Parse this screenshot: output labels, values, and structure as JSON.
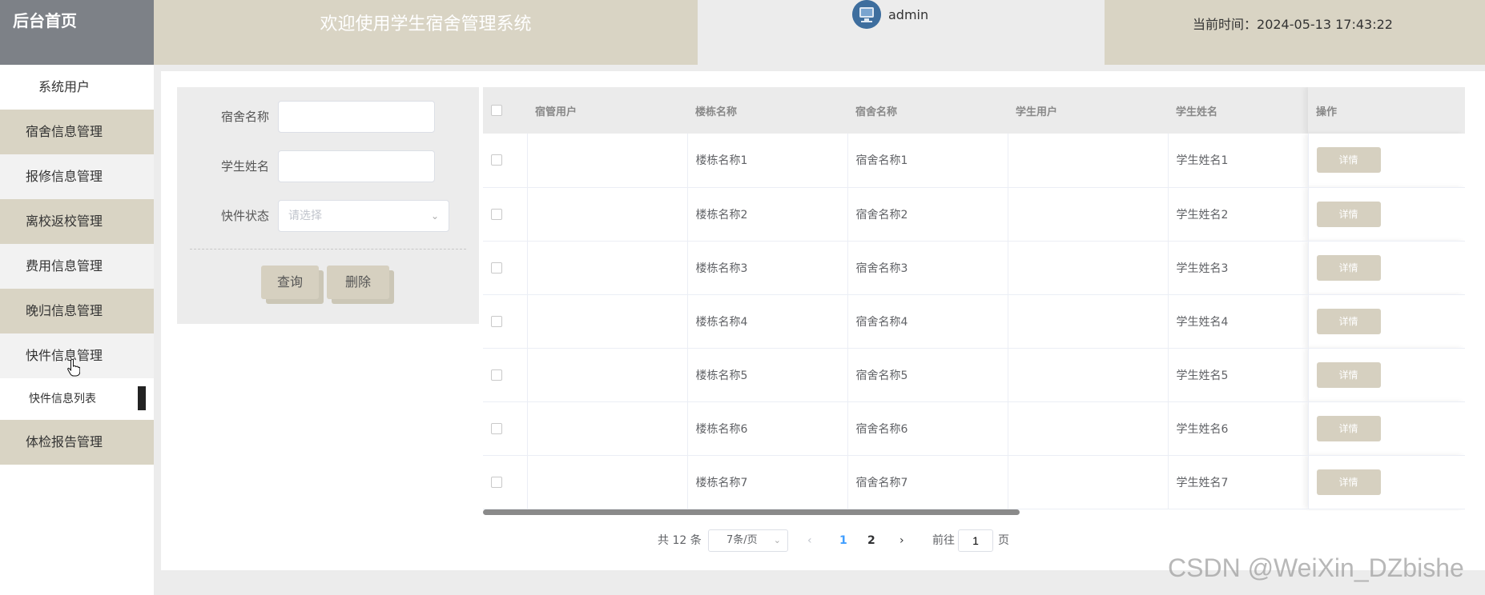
{
  "header": {
    "brand": "后台首页",
    "welcome": "欢迎使用学生宿舍管理系统",
    "username": "admin",
    "time_label": "当前时间：",
    "time_value": "2024-05-13 17:43:22"
  },
  "sidebar": {
    "items": [
      {
        "label": "系统用户",
        "style": "top"
      },
      {
        "label": "宿舍信息管理",
        "style": "tan"
      },
      {
        "label": "报修信息管理",
        "style": "plain"
      },
      {
        "label": "离校返校管理",
        "style": "tan"
      },
      {
        "label": "费用信息管理",
        "style": "plain"
      },
      {
        "label": "晚归信息管理",
        "style": "tan"
      },
      {
        "label": "快件信息管理",
        "style": "plain"
      }
    ],
    "subitem": "快件信息列表",
    "last_item": "体检报告管理"
  },
  "search": {
    "dorm_name_label": "宿舍名称",
    "dorm_name_value": "",
    "student_name_label": "学生姓名",
    "student_name_value": "",
    "status_label": "快件状态",
    "status_placeholder": "请选择",
    "query_button": "查询",
    "delete_button": "删除"
  },
  "table": {
    "columns": [
      "宿管用户",
      "楼栋名称",
      "宿舍名称",
      "学生用户",
      "学生姓名",
      "操作"
    ],
    "detail_label": "详情",
    "rows": [
      {
        "manager": "",
        "building": "楼栋名称1",
        "dorm": "宿舍名称1",
        "student_user": "",
        "student_name": "学生姓名1"
      },
      {
        "manager": "",
        "building": "楼栋名称2",
        "dorm": "宿舍名称2",
        "student_user": "",
        "student_name": "学生姓名2"
      },
      {
        "manager": "",
        "building": "楼栋名称3",
        "dorm": "宿舍名称3",
        "student_user": "",
        "student_name": "学生姓名3"
      },
      {
        "manager": "",
        "building": "楼栋名称4",
        "dorm": "宿舍名称4",
        "student_user": "",
        "student_name": "学生姓名4"
      },
      {
        "manager": "",
        "building": "楼栋名称5",
        "dorm": "宿舍名称5",
        "student_user": "",
        "student_name": "学生姓名5"
      },
      {
        "manager": "",
        "building": "楼栋名称6",
        "dorm": "宿舍名称6",
        "student_user": "",
        "student_name": "学生姓名6"
      },
      {
        "manager": "",
        "building": "楼栋名称7",
        "dorm": "宿舍名称7",
        "student_user": "",
        "student_name": "学生姓名7"
      }
    ]
  },
  "pagination": {
    "total": "共 12 条",
    "page_size": "7条/页",
    "pages": [
      "1",
      "2"
    ],
    "current_page": "1",
    "goto_prefix": "前往",
    "goto_value": "1",
    "goto_suffix": "页",
    "active_color": "#409eff"
  },
  "watermark": "CSDN @WeiXin_DZbishe",
  "colors": {
    "tan": "#d9d4c4",
    "brand_bg": "#7d8187",
    "button": "#d6d0c0"
  }
}
